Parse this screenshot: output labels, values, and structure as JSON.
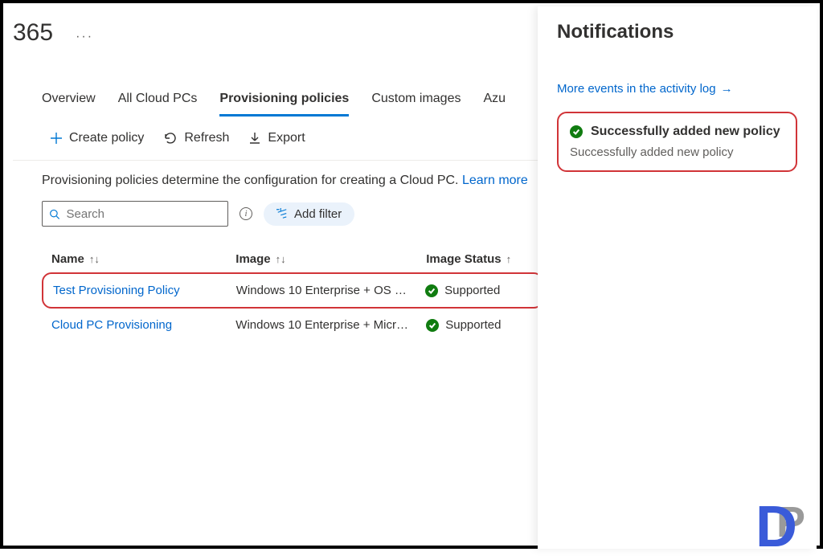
{
  "header": {
    "title": "365",
    "more": "···"
  },
  "tabs": [
    {
      "label": "Overview",
      "active": false
    },
    {
      "label": "All Cloud PCs",
      "active": false
    },
    {
      "label": "Provisioning policies",
      "active": true
    },
    {
      "label": "Custom images",
      "active": false
    },
    {
      "label": "Azu",
      "active": false
    }
  ],
  "toolbar": {
    "create": "Create policy",
    "refresh": "Refresh",
    "export": "Export"
  },
  "description": {
    "text": "Provisioning policies determine the configuration for creating a Cloud PC. ",
    "link": "Learn more"
  },
  "search": {
    "placeholder": "Search"
  },
  "filter": {
    "label": "Add filter"
  },
  "table": {
    "columns": {
      "name": "Name",
      "image": "Image",
      "status": "Image Status"
    },
    "rows": [
      {
        "name": "Test Provisioning Policy",
        "image": "Windows 10 Enterprise + OS …",
        "status": "Supported"
      },
      {
        "name": "Cloud PC Provisioning",
        "image": "Windows 10 Enterprise + Micr…",
        "status": "Supported"
      }
    ]
  },
  "notifications": {
    "title": "Notifications",
    "link": "More events in the activity log",
    "card": {
      "title": "Successfully added new policy",
      "body": "Successfully added new policy"
    }
  }
}
